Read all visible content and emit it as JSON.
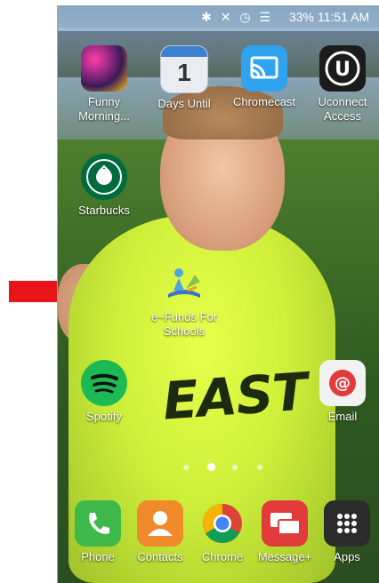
{
  "status_bar": {
    "battery": "33%",
    "time": "11:51 AM"
  },
  "home_apps": [
    {
      "label": "Funny Morning..."
    },
    {
      "label": "Days Until",
      "badge": "1"
    },
    {
      "label": "Chromecast"
    },
    {
      "label": "Uconnect Access"
    },
    {
      "label": "Starbucks"
    },
    {
      "label": "e~Funds For Schools"
    },
    {
      "label": "Spotify"
    },
    {
      "label": "Email"
    }
  ],
  "wallpaper": {
    "shirt_text": "EAST"
  },
  "page_indicator": {
    "count": 4,
    "active": 2
  },
  "dock": [
    {
      "label": "Phone"
    },
    {
      "label": "Contacts"
    },
    {
      "label": "Chrome"
    },
    {
      "label": "Message+"
    },
    {
      "label": "Apps"
    }
  ],
  "colors": {
    "arrow": "#e8141a",
    "spotify": "#1db954",
    "phone": "#3fb84a",
    "contacts": "#f08a2a",
    "message": "#e13b3b"
  }
}
